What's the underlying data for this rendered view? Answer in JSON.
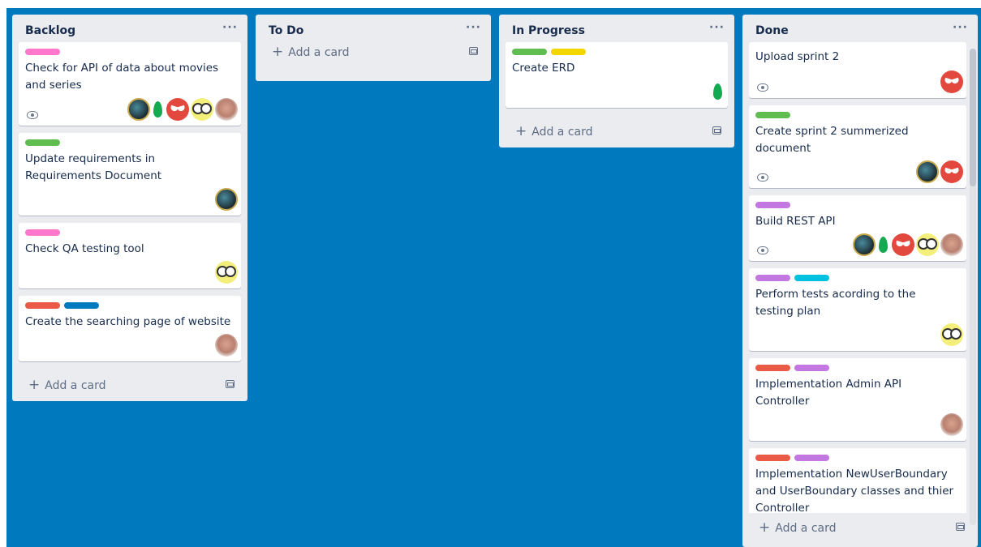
{
  "colors": {
    "board_bg": "#0079bf",
    "list_bg": "#ebecf0",
    "label_pink": "#ff78cb",
    "label_green": "#61bd4f",
    "label_yellow": "#f2d600",
    "label_red": "#eb5a46",
    "label_blue": "#0079bf",
    "label_purple": "#c377e0",
    "label_sky": "#00c2e0"
  },
  "lists": {
    "backlog": {
      "title": "Backlog",
      "menu": "···",
      "add_card": "Add a card",
      "cards": [
        {
          "title": "Check for API of data about movies and series",
          "labels": [
            "pink"
          ],
          "watch": true,
          "members": [
            "earth-avatar",
            "leaf-avatar",
            "red-face-avatar",
            "googly-eyes-avatar",
            "elf-avatar"
          ]
        },
        {
          "title": "Update requirements in Requirements Document",
          "labels": [
            "green"
          ],
          "watch": false,
          "members": [
            "earth-avatar"
          ]
        },
        {
          "title": "Check QA testing tool",
          "labels": [
            "pink"
          ],
          "watch": false,
          "members": [
            "googly-eyes-avatar"
          ]
        },
        {
          "title": "Create the searching page of website",
          "labels": [
            "red",
            "blue"
          ],
          "watch": false,
          "members": [
            "elf-avatar"
          ]
        }
      ]
    },
    "todo": {
      "title": "To Do",
      "menu": "···",
      "add_card": "Add a card"
    },
    "in_progress": {
      "title": "In Progress",
      "menu": "···",
      "add_card": "Add a card",
      "cards": [
        {
          "title": "Create ERD",
          "labels": [
            "green",
            "yellow"
          ],
          "watch": false,
          "members": [
            "leaf-avatar"
          ]
        }
      ]
    },
    "done": {
      "title": "Done",
      "menu": "···",
      "add_card": "Add a card",
      "cards": [
        {
          "title": "Upload sprint 2",
          "labels": [],
          "watch": true,
          "members": [
            "red-face-avatar"
          ]
        },
        {
          "title": "Create sprint 2 summerized document",
          "labels": [
            "green"
          ],
          "watch": true,
          "members": [
            "earth-avatar",
            "red-face-avatar"
          ]
        },
        {
          "title": "Build REST API",
          "labels": [
            "purple"
          ],
          "watch": true,
          "members": [
            "earth-avatar",
            "leaf-avatar",
            "red-face-avatar",
            "googly-eyes-avatar",
            "elf-avatar"
          ]
        },
        {
          "title": "Perform tests acording to the testing plan",
          "labels": [
            "purple",
            "sky"
          ],
          "watch": false,
          "members": [
            "googly-eyes-avatar"
          ]
        },
        {
          "title": "Implementation Admin API Controller",
          "labels": [
            "red",
            "purple"
          ],
          "watch": false,
          "members": [
            "elf-avatar"
          ]
        },
        {
          "title": "Implementation NewUserBoundary and UserBoundary classes and thier Controller",
          "labels": [
            "red",
            "purple"
          ],
          "watch": false,
          "members": []
        }
      ]
    }
  }
}
